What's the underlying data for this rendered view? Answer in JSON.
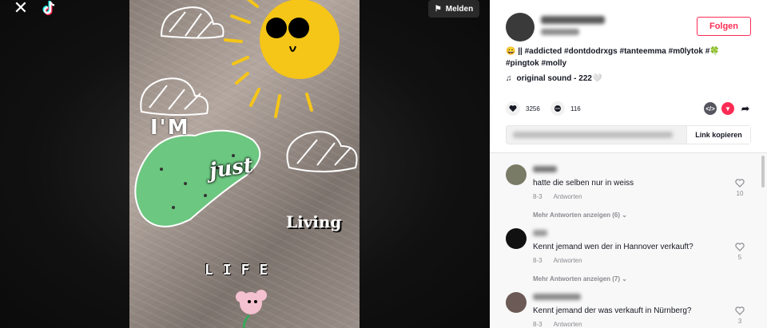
{
  "video": {
    "close_label": "✕",
    "report_label": "Melden",
    "overlay": {
      "im": "I'M",
      "just": "just",
      "living": "Living",
      "life": "LIFE"
    }
  },
  "author": {
    "follow_label": "Folgen"
  },
  "description": {
    "text": "😀 || #addicted #dontdodrxgs #tanteemma #m0lytok #🍀 #pingtok #molly",
    "sound": "original sound - 222🤍"
  },
  "stats": {
    "likes": "3256",
    "comments": "116"
  },
  "link": {
    "copy_label": "Link kopieren"
  },
  "comments": [
    {
      "text": "hatte die selben nur in weiss",
      "date": "8-3",
      "reply_label": "Antworten",
      "like_count": "10",
      "more_label": "Mehr Antworten anzeigen (6)"
    },
    {
      "text": "Kennt jemand wen der in Hannover verkauft?",
      "date": "8-3",
      "reply_label": "Antworten",
      "like_count": "5",
      "more_label": "Mehr Antworten anzeigen (7)"
    },
    {
      "text": "Kennt jemand der was verkauft in Nürnberg?",
      "date": "8-3",
      "reply_label": "Antworten",
      "like_count": "3"
    }
  ],
  "colors": {
    "accent": "#fe2c55",
    "text": "#161823",
    "muted": "#8a8b91"
  }
}
